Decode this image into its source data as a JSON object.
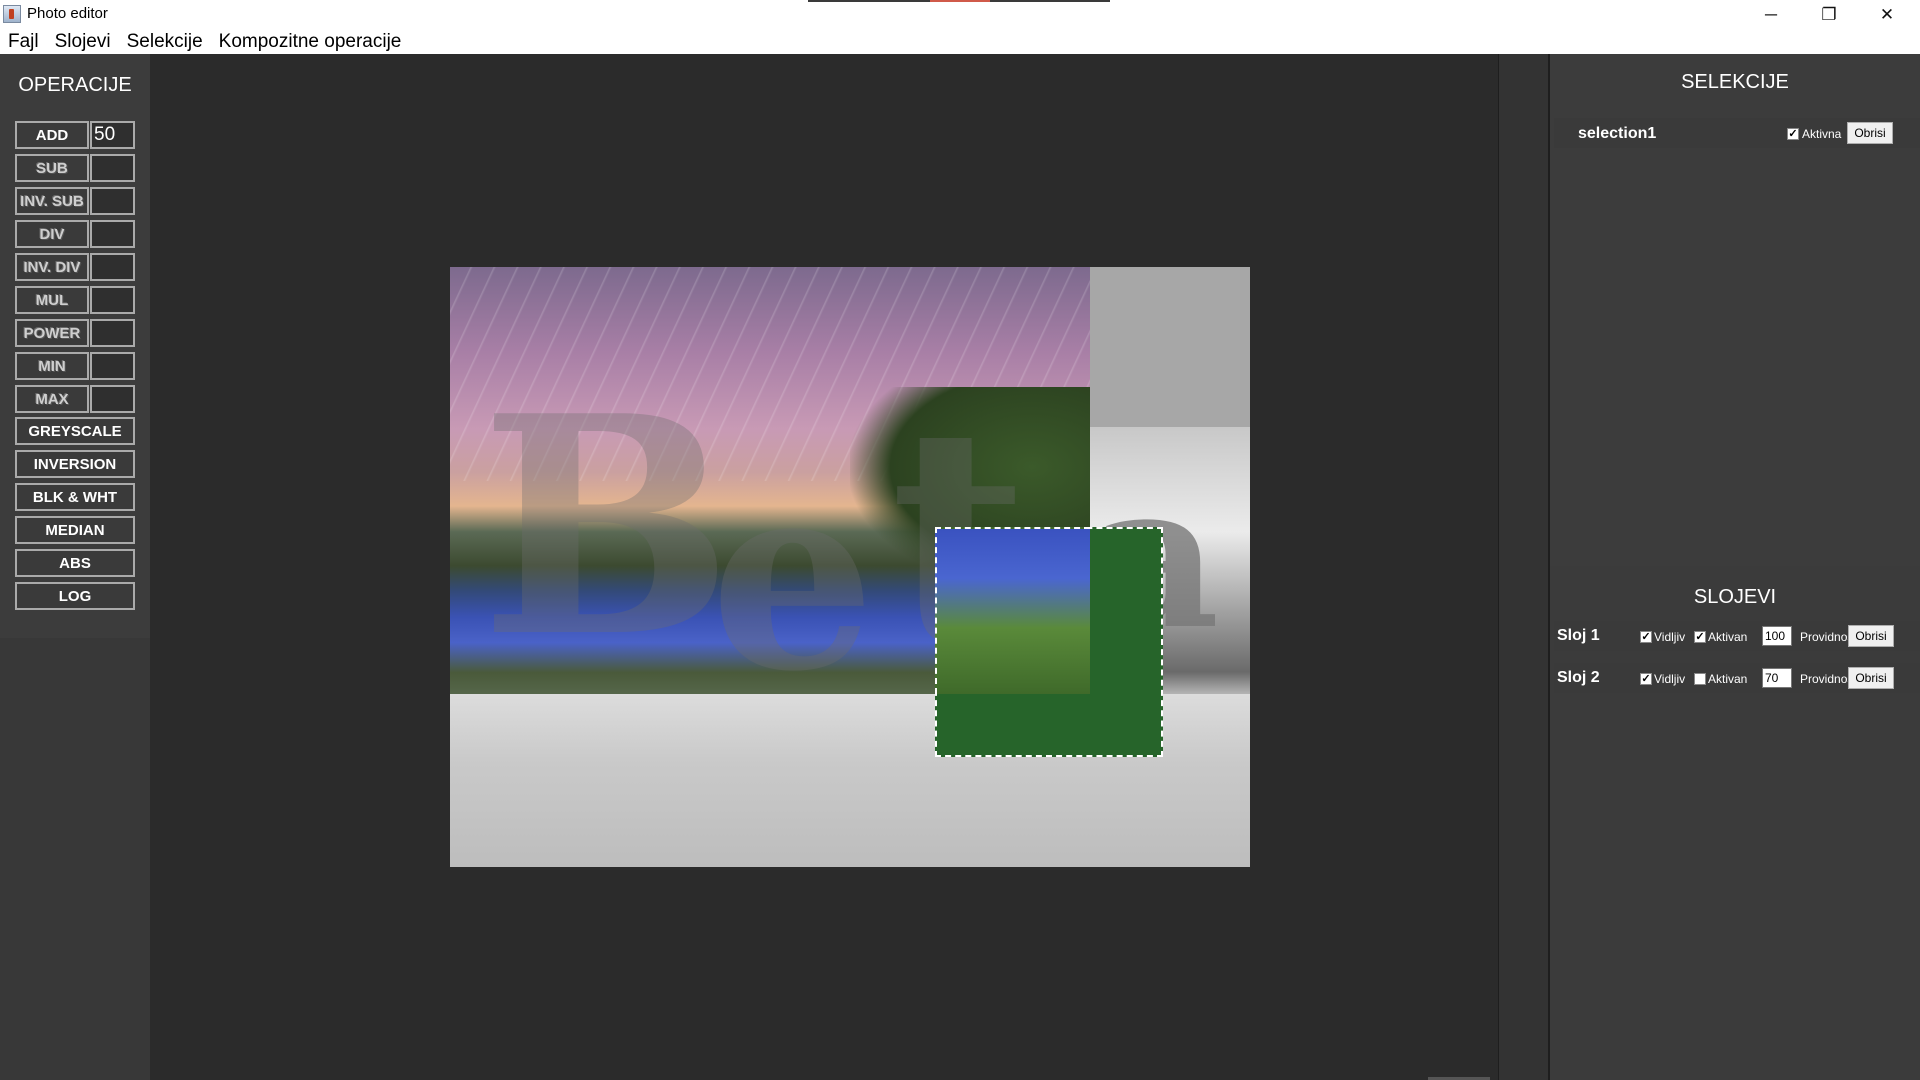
{
  "window": {
    "title": "Photo editor",
    "min_glyph": "─",
    "max_glyph": "❐",
    "close_glyph": "✕"
  },
  "menu": [
    "Fajl",
    "Slojevi",
    "Selekcije",
    "Kompozitne operacije"
  ],
  "operations": {
    "title": "OPERACIJE",
    "param_buttons": [
      {
        "label": "ADD",
        "value": "50"
      },
      {
        "label": "SUB",
        "value": ""
      },
      {
        "label": "INV. SUB",
        "value": ""
      },
      {
        "label": "DIV",
        "value": ""
      },
      {
        "label": "INV. DIV",
        "value": ""
      },
      {
        "label": "MUL",
        "value": ""
      },
      {
        "label": "POWER",
        "value": ""
      },
      {
        "label": "MIN",
        "value": ""
      },
      {
        "label": "MAX",
        "value": ""
      }
    ],
    "simple_buttons": [
      "GREYSCALE",
      "INVERSION",
      "BLK & WHT",
      "MEDIAN",
      "ABS",
      "LOG"
    ]
  },
  "selections": {
    "title": "SELEKCIJE",
    "items": [
      {
        "name": "selection1",
        "active_label": "Aktivna",
        "active": true,
        "delete_label": "Obrisi"
      }
    ]
  },
  "layers": {
    "title": "SLOJEVI",
    "items": [
      {
        "name": "Sloj 1",
        "visible_label": "Vidljiv",
        "visible": true,
        "active_label": "Aktivan",
        "active": true,
        "opacity": "100",
        "opacity_label": "Providnost",
        "delete_label": "Obrisi"
      },
      {
        "name": "Sloj 2",
        "visible_label": "Vidljiv",
        "visible": true,
        "active_label": "Aktivan",
        "active": false,
        "opacity": "70",
        "opacity_label": "Providnost",
        "delete_label": "Obrisi"
      }
    ]
  },
  "canvas": {
    "ghost_letters": [
      "B",
      "e",
      "t",
      "a"
    ]
  },
  "colors": {
    "selection_fill": "#26642a",
    "panel_bg": "#3c3c3c",
    "workspace_bg": "#2b2b2b"
  }
}
